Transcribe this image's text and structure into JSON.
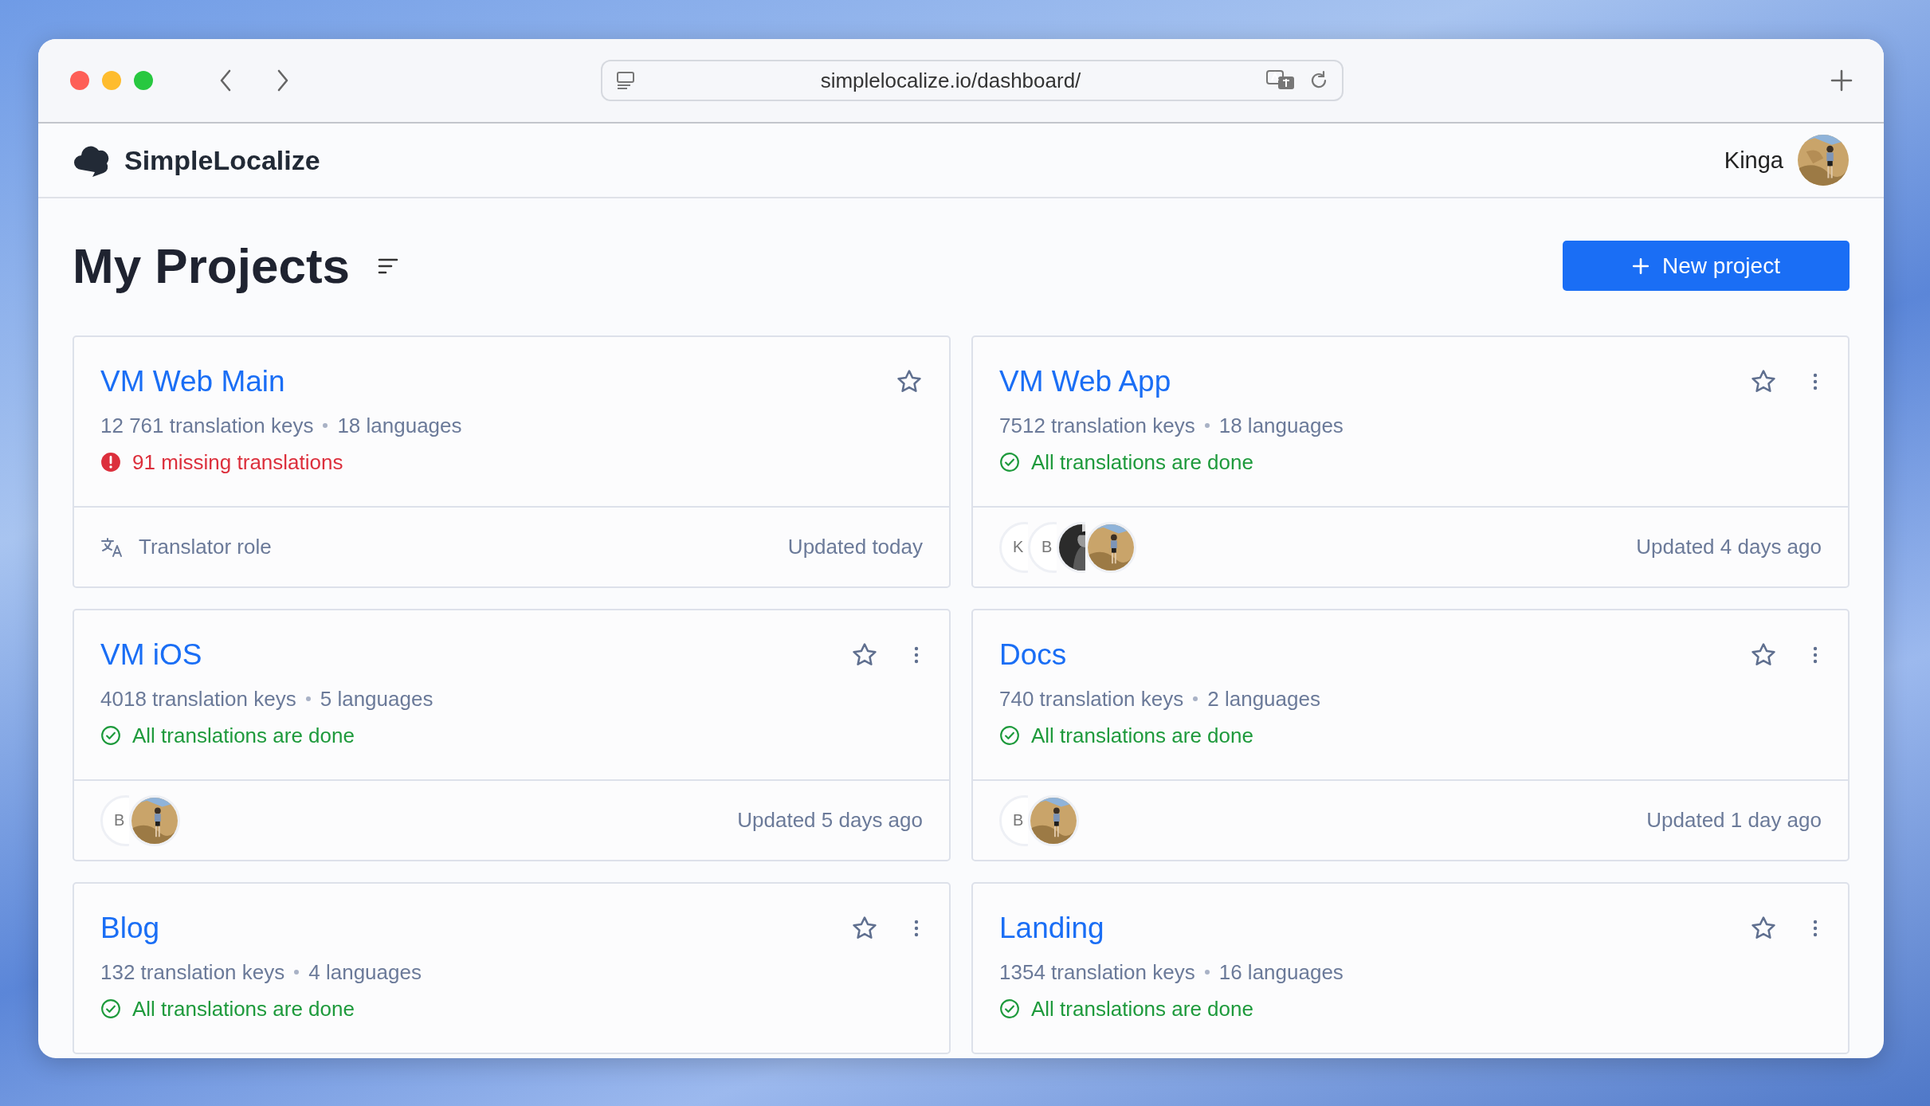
{
  "browser": {
    "url": "simplelocalize.io/dashboard/"
  },
  "app": {
    "brand": "SimpleLocalize",
    "user": {
      "name": "Kinga",
      "avatar": {
        "kind": "picture"
      }
    }
  },
  "page": {
    "title": "My Projects",
    "new_button": "New project"
  },
  "projects": [
    {
      "name": "VM Web Main",
      "keys": "12 761 translation keys",
      "languages": "18 languages",
      "status": {
        "kind": "missing",
        "text": "91 missing translations"
      },
      "menu": false,
      "footer": {
        "kind": "role",
        "role": "Translator role",
        "updated": "Updated today"
      }
    },
    {
      "name": "VM Web App",
      "keys": "7512 translation keys",
      "languages": "18 languages",
      "status": {
        "kind": "done",
        "text": "All translations are done"
      },
      "menu": true,
      "footer": {
        "kind": "members",
        "members": [
          {
            "kind": "initials",
            "text": "K"
          },
          {
            "kind": "initials",
            "text": "B"
          },
          {
            "kind": "picture"
          },
          {
            "kind": "picture"
          }
        ],
        "updated": "Updated 4 days ago"
      }
    },
    {
      "name": "VM iOS",
      "keys": "4018 translation keys",
      "languages": "5 languages",
      "status": {
        "kind": "done",
        "text": "All translations are done"
      },
      "menu": true,
      "footer": {
        "kind": "members",
        "members": [
          {
            "kind": "initials",
            "text": "B"
          },
          {
            "kind": "picture"
          }
        ],
        "updated": "Updated 5 days ago"
      }
    },
    {
      "name": "Docs",
      "keys": "740 translation keys",
      "languages": "2 languages",
      "status": {
        "kind": "done",
        "text": "All translations are done"
      },
      "menu": true,
      "footer": {
        "kind": "members",
        "members": [
          {
            "kind": "initials",
            "text": "B"
          },
          {
            "kind": "picture"
          }
        ],
        "updated": "Updated 1 day ago"
      }
    },
    {
      "name": "Blog",
      "keys": "132 translation keys",
      "languages": "4 languages",
      "status": {
        "kind": "done",
        "text": "All translations are done"
      },
      "menu": true
    },
    {
      "name": "Landing",
      "keys": "1354 translation keys",
      "languages": "16 languages",
      "status": {
        "kind": "done",
        "text": "All translations are done"
      },
      "menu": true
    }
  ]
}
